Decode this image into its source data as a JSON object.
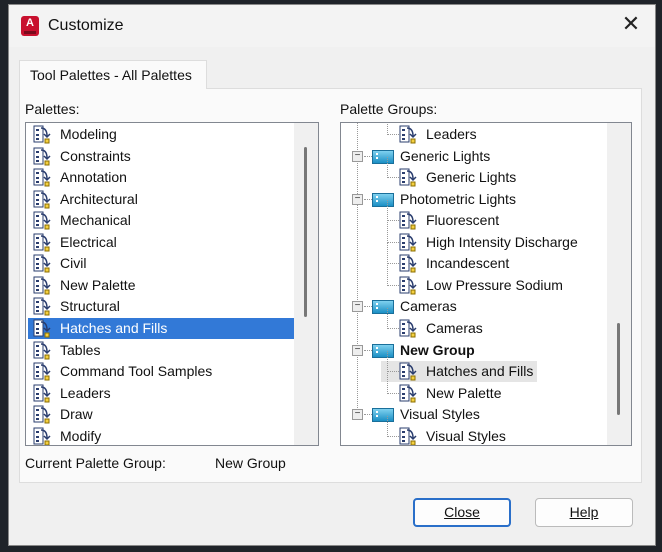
{
  "window": {
    "title": "Customize",
    "close_glyph": "✕",
    "app_icon": "A"
  },
  "tab": {
    "label": "Tool Palettes - All Palettes"
  },
  "palettes": {
    "label": "Palettes:",
    "items": [
      "Modeling",
      "Constraints",
      "Annotation",
      "Architectural",
      "Mechanical",
      "Electrical",
      "Civil",
      "New Palette",
      "Structural",
      "Hatches and Fills",
      "Tables",
      "Command Tool Samples",
      "Leaders",
      "Draw",
      "Modify"
    ],
    "selected_index": 9
  },
  "groups": {
    "label": "Palette Groups:",
    "items": [
      {
        "label": "Leaders",
        "level": 2
      },
      {
        "label": "Generic Lights",
        "level": 1
      },
      {
        "label": "Generic Lights",
        "level": 2
      },
      {
        "label": "Photometric Lights",
        "level": 1
      },
      {
        "label": "Fluorescent",
        "level": 2
      },
      {
        "label": "High Intensity Discharge",
        "level": 2
      },
      {
        "label": "Incandescent",
        "level": 2
      },
      {
        "label": "Low Pressure Sodium",
        "level": 2
      },
      {
        "label": "Cameras",
        "level": 1
      },
      {
        "label": "Cameras",
        "level": 2
      },
      {
        "label": "New Group",
        "level": 1,
        "bold": true
      },
      {
        "label": "Hatches and Fills",
        "level": 2,
        "hover": true
      },
      {
        "label": "New Palette",
        "level": 2
      },
      {
        "label": "Visual Styles",
        "level": 1
      },
      {
        "label": "Visual Styles",
        "level": 2
      }
    ]
  },
  "current_group": {
    "label": "Current Palette Group:",
    "value": "New Group"
  },
  "buttons": {
    "close": "Close",
    "help": "Help"
  }
}
